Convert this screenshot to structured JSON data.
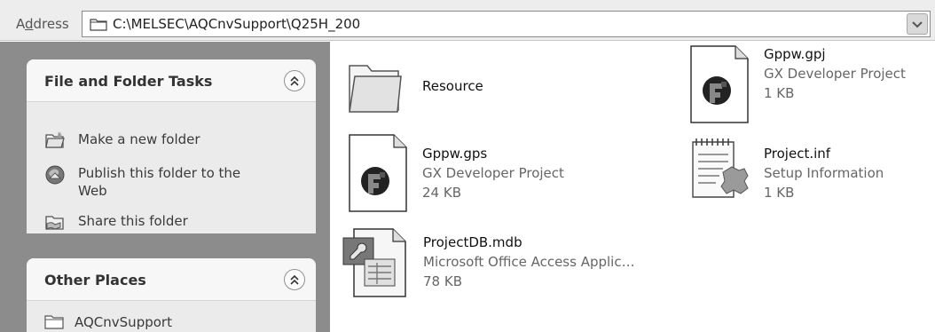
{
  "address": {
    "label_prefix": "A",
    "label_underlined": "d",
    "label_suffix": "dress",
    "path": "C:\\MELSEC\\AQCnvSupport\\Q25H_200"
  },
  "tasks_panel": {
    "title": "File and Folder Tasks",
    "items": [
      {
        "label": "Make a new folder",
        "icon": "new-folder-icon"
      },
      {
        "label": "Publish this folder to the",
        "label2": "Web",
        "icon": "publish-web-icon"
      },
      {
        "label": "Share this folder",
        "icon": "share-folder-icon"
      }
    ]
  },
  "places_panel": {
    "title": "Other Places",
    "items": [
      {
        "label": "AQCnvSupport",
        "icon": "folder-icon"
      }
    ]
  },
  "files": [
    {
      "name": "Resource",
      "type": "",
      "size": "",
      "icon": "folder-icon"
    },
    {
      "name": "Gppw.gpj",
      "type": "GX Developer Project",
      "size": "1 KB",
      "icon": "gx-developer-icon"
    },
    {
      "name": "Gppw.gps",
      "type": "GX Developer Project",
      "size": "24 KB",
      "icon": "gx-developer-icon"
    },
    {
      "name": "Project.inf",
      "type": "Setup Information",
      "size": "1 KB",
      "icon": "setup-information-icon"
    },
    {
      "name": "ProjectDB.mdb",
      "type": "Microsoft Office Access Applic…",
      "size": "78 KB",
      "icon": "access-database-icon"
    }
  ]
}
